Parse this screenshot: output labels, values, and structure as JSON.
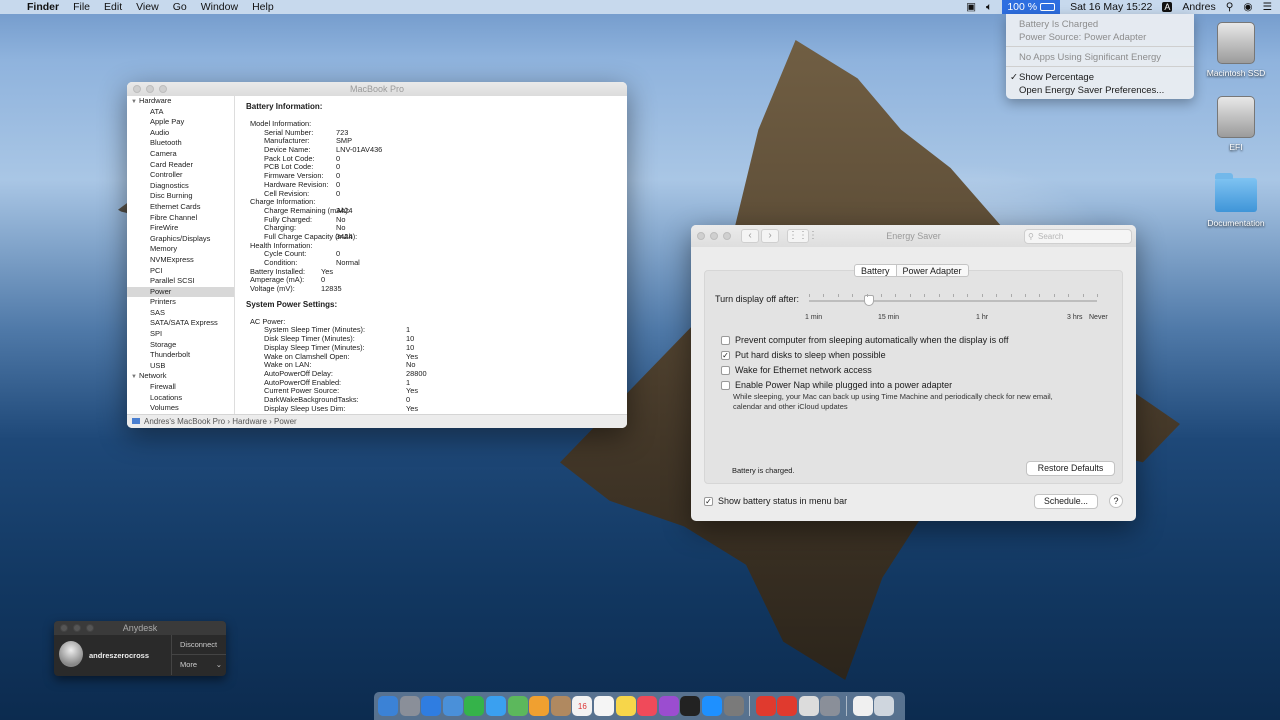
{
  "menubar": {
    "apple": "",
    "app": "Finder",
    "items": [
      "File",
      "Edit",
      "View",
      "Go",
      "Window",
      "Help"
    ],
    "battery_text": "100 %",
    "datetime": "Sat 16 May  15:22",
    "input_badge": "A",
    "user": "Andres"
  },
  "battery_menu": {
    "items": [
      {
        "label": "Battery Is Charged",
        "disabled": true
      },
      {
        "label": "Power Source: Power Adapter",
        "disabled": true
      },
      {
        "label": "No Apps Using Significant Energy",
        "disabled": true
      },
      {
        "label": "Show Percentage",
        "checked": true
      },
      {
        "label": "Open Energy Saver Preferences..."
      }
    ]
  },
  "desktop": {
    "icons": [
      {
        "label": "Macintosh SSD"
      },
      {
        "label": "EFI"
      },
      {
        "label": "Documentation"
      }
    ]
  },
  "sysinfo": {
    "title": "MacBook Pro",
    "sidebar": [
      {
        "label": "Hardware",
        "group": true
      },
      {
        "label": "ATA"
      },
      {
        "label": "Apple Pay"
      },
      {
        "label": "Audio"
      },
      {
        "label": "Bluetooth"
      },
      {
        "label": "Camera"
      },
      {
        "label": "Card Reader"
      },
      {
        "label": "Controller"
      },
      {
        "label": "Diagnostics"
      },
      {
        "label": "Disc Burning"
      },
      {
        "label": "Ethernet Cards"
      },
      {
        "label": "Fibre Channel"
      },
      {
        "label": "FireWire"
      },
      {
        "label": "Graphics/Displays"
      },
      {
        "label": "Memory"
      },
      {
        "label": "NVMExpress"
      },
      {
        "label": "PCI"
      },
      {
        "label": "Parallel SCSI"
      },
      {
        "label": "Power",
        "selected": true
      },
      {
        "label": "Printers"
      },
      {
        "label": "SAS"
      },
      {
        "label": "SATA/SATA Express"
      },
      {
        "label": "SPI"
      },
      {
        "label": "Storage"
      },
      {
        "label": "Thunderbolt"
      },
      {
        "label": "USB"
      },
      {
        "label": "Network",
        "group": true
      },
      {
        "label": "Firewall"
      },
      {
        "label": "Locations"
      },
      {
        "label": "Volumes"
      }
    ],
    "battery_heading": "Battery Information:",
    "battery_rows": [
      {
        "k": "Model Information:",
        "v": "",
        "i": 1
      },
      {
        "k": "Serial Number:",
        "v": "723",
        "i": 2
      },
      {
        "k": "Manufacturer:",
        "v": "SMP",
        "i": 2
      },
      {
        "k": "Device Name:",
        "v": "LNV-01AV436",
        "i": 2
      },
      {
        "k": "Pack Lot Code:",
        "v": "0",
        "i": 2
      },
      {
        "k": "PCB Lot Code:",
        "v": "0",
        "i": 2
      },
      {
        "k": "Firmware Version:",
        "v": "0",
        "i": 2
      },
      {
        "k": "Hardware Revision:",
        "v": "0",
        "i": 2
      },
      {
        "k": "Cell Revision:",
        "v": "0",
        "i": 2
      },
      {
        "k": "Charge Information:",
        "v": "",
        "i": 1
      },
      {
        "k": "Charge Remaining (mAh):",
        "v": "3424",
        "i": 2
      },
      {
        "k": "Fully Charged:",
        "v": "No",
        "i": 2
      },
      {
        "k": "Charging:",
        "v": "No",
        "i": 2
      },
      {
        "k": "Full Charge Capacity (mAh):",
        "v": "3424",
        "i": 2
      },
      {
        "k": "Health Information:",
        "v": "",
        "i": 1
      },
      {
        "k": "Cycle Count:",
        "v": "0",
        "i": 2
      },
      {
        "k": "Condition:",
        "v": "Normal",
        "i": 2
      },
      {
        "k": "Battery Installed:",
        "v": "Yes",
        "i": 1
      },
      {
        "k": "Amperage (mA):",
        "v": "0",
        "i": 1
      },
      {
        "k": "Voltage (mV):",
        "v": "12835",
        "i": 1
      }
    ],
    "power_heading": "System Power Settings:",
    "power_rows": [
      {
        "k": "AC Power:",
        "v": "",
        "i": 1
      },
      {
        "k": "System Sleep Timer (Minutes):",
        "v": "1",
        "i": 2
      },
      {
        "k": "Disk Sleep Timer (Minutes):",
        "v": "10",
        "i": 2
      },
      {
        "k": "Display Sleep Timer (Minutes):",
        "v": "10",
        "i": 2
      },
      {
        "k": "Wake on Clamshell Open:",
        "v": "Yes",
        "i": 2
      },
      {
        "k": "Wake on LAN:",
        "v": "No",
        "i": 2
      },
      {
        "k": "AutoPowerOff Delay:",
        "v": "28800",
        "i": 2
      },
      {
        "k": "AutoPowerOff Enabled:",
        "v": "1",
        "i": 2
      },
      {
        "k": "Current Power Source:",
        "v": "Yes",
        "i": 2
      },
      {
        "k": "DarkWakeBackgroundTasks:",
        "v": "0",
        "i": 2
      },
      {
        "k": "Display Sleep Uses Dim:",
        "v": "Yes",
        "i": 2
      }
    ],
    "path": "Andres's MacBook Pro  ›  Hardware  ›  Power"
  },
  "energy": {
    "title": "Energy Saver",
    "search_placeholder": "Search",
    "tabs": [
      {
        "label": "Battery",
        "active": true
      },
      {
        "label": "Power Adapter"
      }
    ],
    "slider_label": "Turn display off after:",
    "slider_position": 0.21,
    "slider_scale": [
      "1 min",
      "15 min",
      "1 hr",
      "3 hrs",
      "Never"
    ],
    "options": [
      {
        "label": "Prevent computer from sleeping automatically when the display is off",
        "checked": false
      },
      {
        "label": "Put hard disks to sleep when possible",
        "checked": true
      },
      {
        "label": "Wake for Ethernet network access",
        "checked": false
      },
      {
        "label": "Enable Power Nap while plugged into a power adapter",
        "checked": false
      }
    ],
    "power_nap_desc": "While sleeping, your Mac can back up using Time Machine and periodically check for new email, calendar and other iCloud updates",
    "status": "Battery is charged.",
    "restore_label": "Restore Defaults",
    "show_battery_label": "Show battery status in menu bar",
    "show_battery_checked": true,
    "schedule_label": "Schedule...",
    "help_label": "?"
  },
  "anydesk": {
    "title": "Anydesk",
    "user": "andreszerocross",
    "disconnect": "Disconnect",
    "more": "More"
  },
  "dock": {
    "icons": [
      "finder-icon",
      "launchpad-icon",
      "safari-icon",
      "mail-icon",
      "facetime-icon",
      "messages-icon",
      "maps-icon",
      "photos-icon",
      "contacts-icon",
      "calendar-icon",
      "reminders-icon",
      "notes-icon",
      "music-icon",
      "podcasts-icon",
      "tv-icon",
      "app-store-icon",
      "system-preferences-icon",
      "anydesk-icon",
      "anydesk-alt-icon",
      "preview-icon",
      "installer-icon",
      "document-icon",
      "trash-icon"
    ],
    "calendar_day": "16"
  }
}
